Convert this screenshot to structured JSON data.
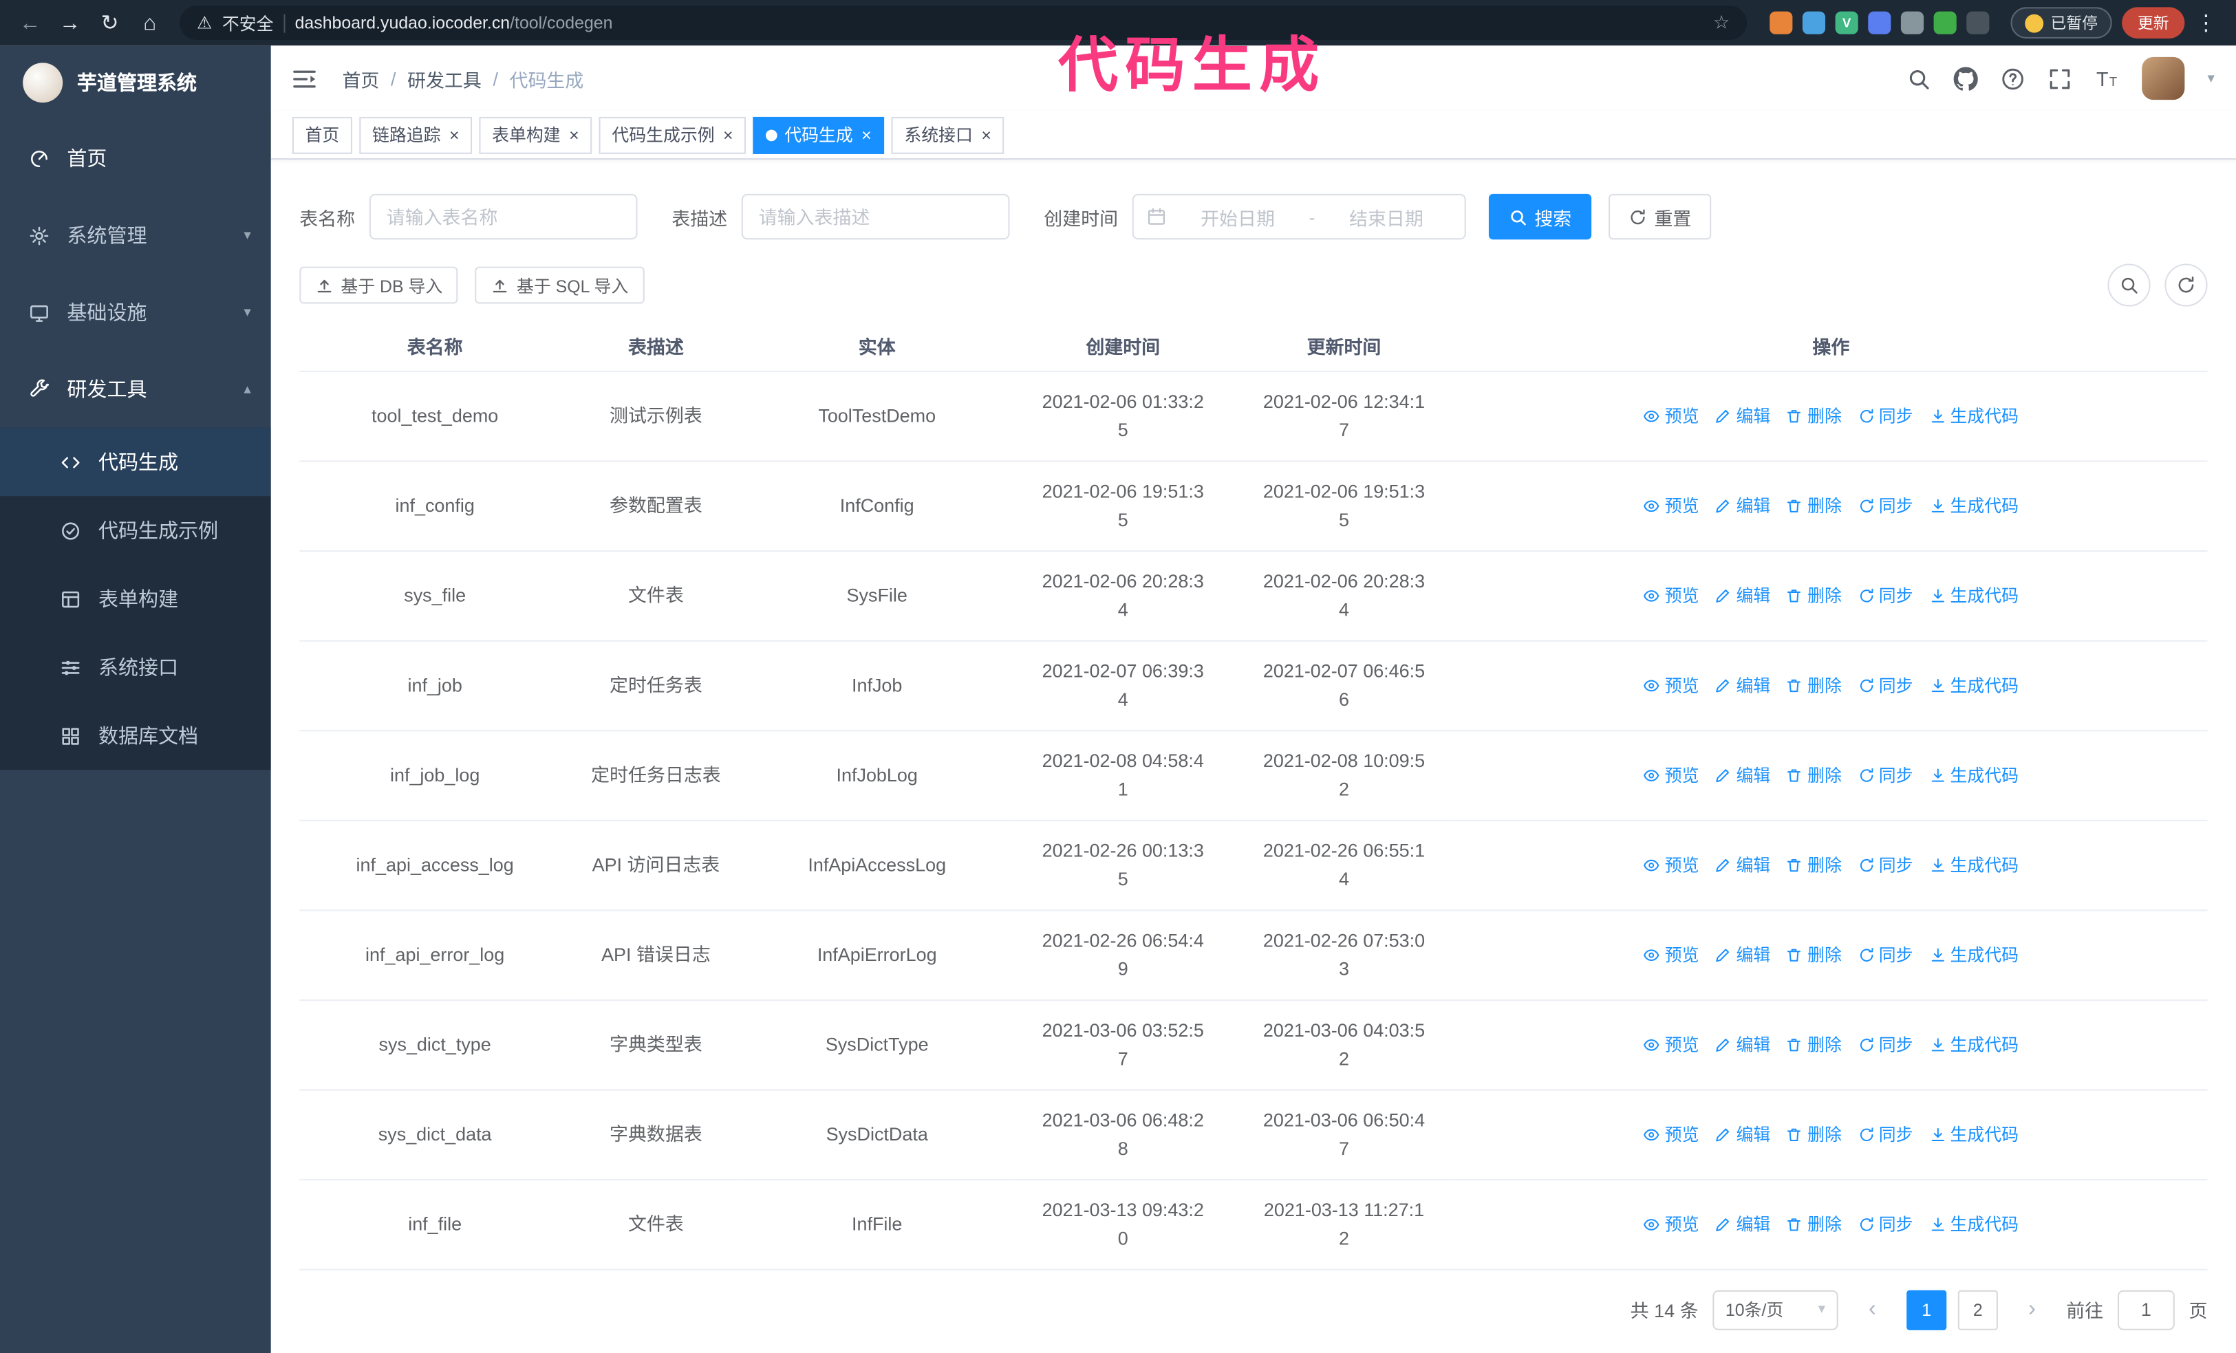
{
  "colors": {
    "primary": "#1890ff",
    "sidebar_bg": "#304156",
    "submenu_bg": "#1f2d3d",
    "submenu_active_bg": "#27405c",
    "chrome_bg": "#1d2935",
    "overlay_pink": "#f93a80",
    "update_red": "#c5473a"
  },
  "browser": {
    "security_label": "不安全",
    "url_host": "dashboard.yudao.iocoder.cn",
    "url_path": "/tool/codegen",
    "paused_badge": "已暂停",
    "update_button": "更新",
    "extensions": [
      {
        "name": "extension-orange",
        "color": "#e8833a",
        "glyph": ""
      },
      {
        "name": "extension-blue-drop",
        "color": "#4aa3e0",
        "glyph": ""
      },
      {
        "name": "extension-vue",
        "color": "#41b883",
        "glyph": "V"
      },
      {
        "name": "extension-people",
        "color": "#5a7df0",
        "glyph": ""
      },
      {
        "name": "extension-capture",
        "color": "#87969c",
        "glyph": ""
      },
      {
        "name": "extension-leaf",
        "color": "#3fae49",
        "glyph": ""
      },
      {
        "name": "extension-puzzle",
        "color": "#49535c",
        "glyph": ""
      }
    ]
  },
  "overlay_title": "代码生成",
  "sidebar": {
    "logo_title": "芋道管理系统",
    "items": [
      {
        "id": "home",
        "label": "首页",
        "icon": "dashboard"
      },
      {
        "id": "system",
        "label": "系统管理",
        "icon": "gear",
        "expandable": true
      },
      {
        "id": "infra",
        "label": "基础设施",
        "icon": "monitor",
        "expandable": true
      },
      {
        "id": "devtools",
        "label": "研发工具",
        "icon": "tools",
        "expandable": true,
        "expanded": true,
        "children": [
          {
            "id": "codegen",
            "label": "代码生成",
            "icon": "code",
            "active": true
          },
          {
            "id": "codegen-demo",
            "label": "代码生成示例",
            "icon": "badge"
          },
          {
            "id": "form-builder",
            "label": "表单构建",
            "icon": "form"
          },
          {
            "id": "api",
            "label": "系统接口",
            "icon": "sliders"
          },
          {
            "id": "db-doc",
            "label": "数据库文档",
            "icon": "grid"
          }
        ]
      }
    ]
  },
  "header": {
    "breadcrumb": [
      "首页",
      "研发工具",
      "代码生成"
    ],
    "breadcrumb_separator": "/"
  },
  "tabs": [
    {
      "id": "home",
      "label": "首页",
      "closable": false
    },
    {
      "id": "tracer",
      "label": "链路追踪",
      "closable": true
    },
    {
      "id": "form-builder",
      "label": "表单构建",
      "closable": true
    },
    {
      "id": "codegen-demo",
      "label": "代码生成示例",
      "closable": true
    },
    {
      "id": "codegen",
      "label": "代码生成",
      "closable": true,
      "active": true
    },
    {
      "id": "api",
      "label": "系统接口",
      "closable": true
    }
  ],
  "filters": {
    "table_name_label": "表名称",
    "table_name_placeholder": "请输入表名称",
    "table_desc_label": "表描述",
    "table_desc_placeholder": "请输入表描述",
    "create_time_label": "创建时间",
    "date_start_placeholder": "开始日期",
    "date_separator": "-",
    "date_end_placeholder": "结束日期",
    "search_button": "搜索",
    "reset_button": "重置"
  },
  "toolbar": {
    "import_db_button": "基于 DB 导入",
    "import_sql_button": "基于 SQL 导入"
  },
  "table": {
    "columns": [
      "表名称",
      "表描述",
      "实体",
      "创建时间",
      "更新时间",
      "操作"
    ],
    "actions": [
      {
        "id": "preview",
        "label": "预览",
        "icon": "eye"
      },
      {
        "id": "edit",
        "label": "编辑",
        "icon": "edit"
      },
      {
        "id": "delete",
        "label": "删除",
        "icon": "delete"
      },
      {
        "id": "sync",
        "label": "同步",
        "icon": "sync"
      },
      {
        "id": "generate",
        "label": "生成代码",
        "icon": "download"
      }
    ],
    "rows": [
      {
        "name": "tool_test_demo",
        "desc": "测试示例表",
        "entity": "ToolTestDemo",
        "created": "2021-02-06 01:33:25",
        "updated": "2021-02-06 12:34:17"
      },
      {
        "name": "inf_config",
        "desc": "参数配置表",
        "entity": "InfConfig",
        "created": "2021-02-06 19:51:35",
        "updated": "2021-02-06 19:51:35"
      },
      {
        "name": "sys_file",
        "desc": "文件表",
        "entity": "SysFile",
        "created": "2021-02-06 20:28:34",
        "updated": "2021-02-06 20:28:34"
      },
      {
        "name": "inf_job",
        "desc": "定时任务表",
        "entity": "InfJob",
        "created": "2021-02-07 06:39:34",
        "updated": "2021-02-07 06:46:56"
      },
      {
        "name": "inf_job_log",
        "desc": "定时任务日志表",
        "entity": "InfJobLog",
        "created": "2021-02-08 04:58:41",
        "updated": "2021-02-08 10:09:52"
      },
      {
        "name": "inf_api_access_log",
        "desc": "API 访问日志表",
        "entity": "InfApiAccessLog",
        "created": "2021-02-26 00:13:35",
        "updated": "2021-02-26 06:55:14"
      },
      {
        "name": "inf_api_error_log",
        "desc": "API 错误日志",
        "entity": "InfApiErrorLog",
        "created": "2021-02-26 06:54:49",
        "updated": "2021-02-26 07:53:03"
      },
      {
        "name": "sys_dict_type",
        "desc": "字典类型表",
        "entity": "SysDictType",
        "created": "2021-03-06 03:52:57",
        "updated": "2021-03-06 04:03:52"
      },
      {
        "name": "sys_dict_data",
        "desc": "字典数据表",
        "entity": "SysDictData",
        "created": "2021-03-06 06:48:28",
        "updated": "2021-03-06 06:50:47"
      },
      {
        "name": "inf_file",
        "desc": "文件表",
        "entity": "InfFile",
        "created": "2021-03-13 09:43:20",
        "updated": "2021-03-13 11:27:12"
      }
    ]
  },
  "pagination": {
    "total_text": "共 14 条",
    "page_size": "10条/页",
    "pages": [
      {
        "label": "1",
        "active": true
      },
      {
        "label": "2",
        "active": false
      }
    ],
    "goto_label": "前往",
    "goto_value": "1",
    "goto_unit": "页"
  }
}
